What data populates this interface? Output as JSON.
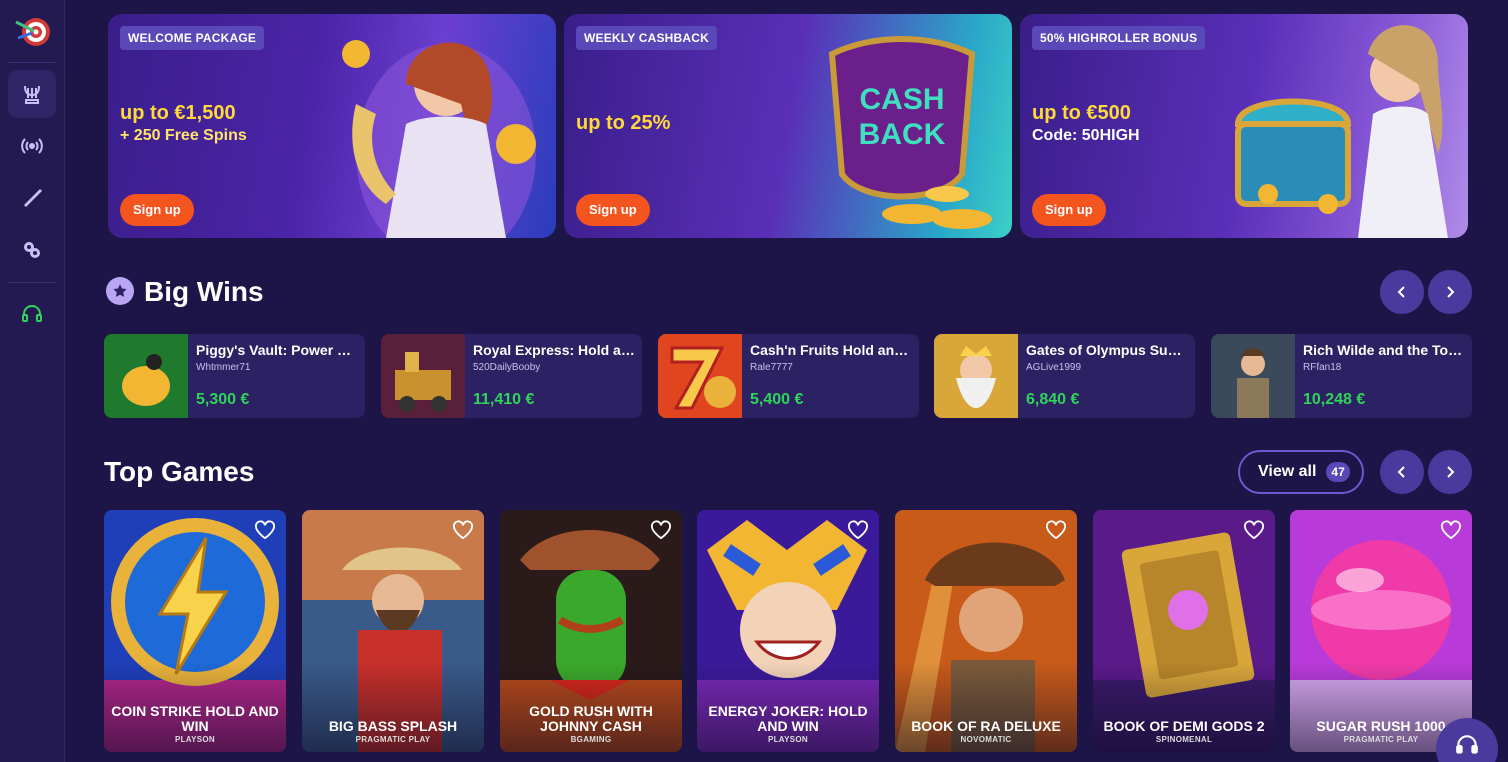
{
  "sidebar": {
    "items": [
      {
        "icon": "lyre-icon",
        "active": true
      },
      {
        "icon": "live-broadcast-icon",
        "active": false
      },
      {
        "icon": "sports-icon",
        "active": false
      },
      {
        "icon": "promotions-icon",
        "active": false
      },
      {
        "icon": "support-headset-icon",
        "active": false
      }
    ]
  },
  "banners": [
    {
      "tag": "WELCOME PACKAGE",
      "headline": "up to €1,500",
      "sub": "+ 250 Free Spins",
      "button": "Sign up"
    },
    {
      "tag": "WEEKLY CASHBACK",
      "headline": "up to 25%",
      "sub": "",
      "button": "Sign up"
    },
    {
      "tag": "50% HIGHROLLER BONUS",
      "headline": "up to €500",
      "sub": "Code: 50HIGH",
      "button": "Sign up"
    }
  ],
  "big_wins": {
    "title": "Big Wins",
    "items": [
      {
        "game": "Piggy's Vault: Power Co...",
        "user": "Whtmmer71",
        "amount": "5,300 €"
      },
      {
        "game": "Royal Express: Hold an...",
        "user": "520DailyBooby",
        "amount": "11,410 €"
      },
      {
        "game": "Cash'n Fruits Hold and ...",
        "user": "Rale7777",
        "amount": "5,400 €"
      },
      {
        "game": "Gates of Olympus Supe...",
        "user": "AGLive1999",
        "amount": "6,840 €"
      },
      {
        "game": "Rich Wilde and the Tom...",
        "user": "RFfan18",
        "amount": "10,248 €"
      }
    ]
  },
  "top_games": {
    "title": "Top Games",
    "view_all": "View all",
    "count": "47",
    "items": [
      {
        "title": "COIN STRIKE HOLD AND WIN",
        "provider": "PLAYSON"
      },
      {
        "title": "BIG BASS SPLASH",
        "provider": "PRAGMATIC PLAY"
      },
      {
        "title": "GOLD RUSH WITH JOHNNY CASH",
        "provider": "BGAMING"
      },
      {
        "title": "ENERGY JOKER: HOLD AND WIN",
        "provider": "PLAYSON"
      },
      {
        "title": "BOOK OF RA DELUXE",
        "provider": "NOVOMATIC"
      },
      {
        "title": "BOOK OF DEMI GODS 2",
        "provider": "SPINOMENAL"
      },
      {
        "title": "SUGAR RUSH 1000",
        "provider": "PRAGMATIC PLAY"
      }
    ]
  },
  "colors": {
    "background": "#1d1547",
    "accent": "#f4541d",
    "win_green": "#2fd45a",
    "highlight_yellow": "#ffd93b"
  }
}
